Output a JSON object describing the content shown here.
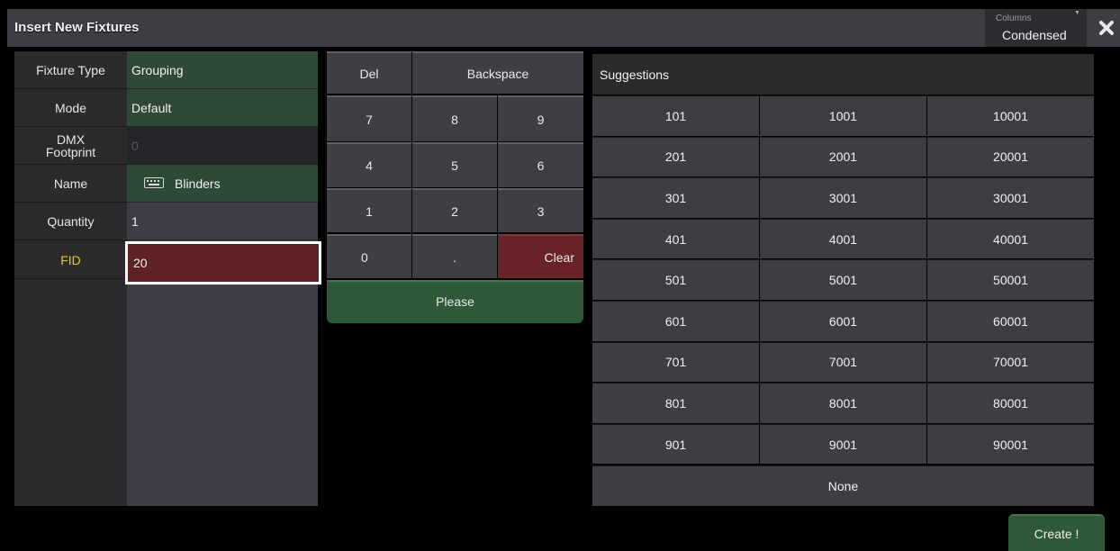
{
  "window": {
    "title": "Insert New Fixtures"
  },
  "columns": {
    "label": "Columns",
    "value": "Condensed"
  },
  "fields": {
    "fixture_type": {
      "label": "Fixture Type",
      "value": "Grouping"
    },
    "mode": {
      "label": "Mode",
      "value": "Default"
    },
    "dmx_footprint": {
      "label_line1": "DMX",
      "label_line2": "Footprint",
      "value": "0"
    },
    "name": {
      "label": "Name",
      "value": "Blinders"
    },
    "quantity": {
      "label": "Quantity",
      "value": "1"
    },
    "fid": {
      "label": "FID",
      "value": "20"
    }
  },
  "keypad": {
    "del": "Del",
    "backspace": "Backspace",
    "k7": "7",
    "k8": "8",
    "k9": "9",
    "k4": "4",
    "k5": "5",
    "k6": "6",
    "k1": "1",
    "k2": "2",
    "k3": "3",
    "k0": "0",
    "dot": ".",
    "clear": "Clear",
    "please": "Please"
  },
  "suggestions": {
    "header": "Suggestions",
    "rows": [
      [
        "101",
        "1001",
        "10001"
      ],
      [
        "201",
        "2001",
        "20001"
      ],
      [
        "301",
        "3001",
        "30001"
      ],
      [
        "401",
        "4001",
        "40001"
      ],
      [
        "501",
        "5001",
        "50001"
      ],
      [
        "601",
        "6001",
        "60001"
      ],
      [
        "701",
        "7001",
        "70001"
      ],
      [
        "801",
        "8001",
        "80001"
      ],
      [
        "901",
        "9001",
        "90001"
      ]
    ],
    "none": "None"
  },
  "create": {
    "label": "Create !"
  },
  "colors": {
    "accent_green": "#2e5836",
    "accent_red": "#6a2427",
    "fid_label": "#f1c31b"
  }
}
